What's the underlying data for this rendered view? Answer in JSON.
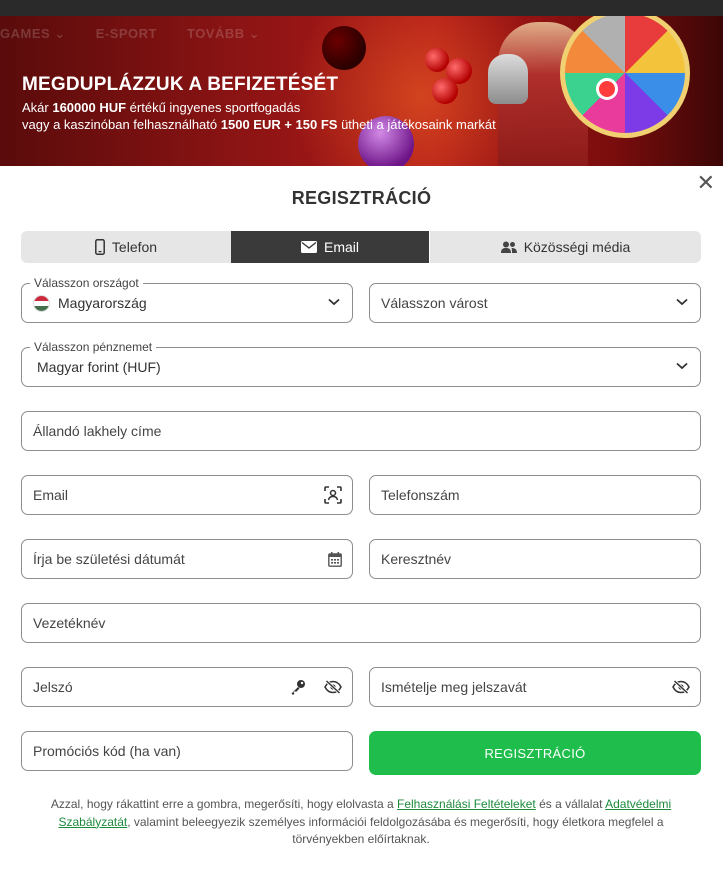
{
  "banner": {
    "nav_ghost": [
      "GAMES ⌄",
      "E-SPORT",
      "TOVÁBB ⌄"
    ],
    "title": "MEGDUPLÁZZUK A BEFIZETÉSÉT",
    "line1_pre": "Akár ",
    "line1_bold": "160000 HUF",
    "line1_post": " értékű ingyenes sportfogadás",
    "line2_pre": "vagy a kaszinóban felhasználható ",
    "line2_bold": "1500 EUR + 150 FS",
    "line2_post": " ütheti a játékosaink markát"
  },
  "modal": {
    "close": "✕",
    "title": "REGISZTRÁCIÓ",
    "tabs": [
      {
        "label": "Telefon",
        "icon": "phone-icon",
        "active": false
      },
      {
        "label": "Email",
        "icon": "envelope-icon",
        "active": true
      },
      {
        "label": "Közösségi média",
        "icon": "users-icon",
        "active": false
      }
    ],
    "country": {
      "legend": "Válasszon országot",
      "value": "Magyarország"
    },
    "city": {
      "placeholder": "Válasszon várost"
    },
    "currency": {
      "legend": "Válasszon pénznemet",
      "value": "Magyar forint (HUF)"
    },
    "address": {
      "placeholder": "Állandó lakhely címe"
    },
    "email": {
      "placeholder": "Email"
    },
    "phone": {
      "placeholder": "Telefonszám"
    },
    "birthdate": {
      "placeholder": "Írja be születési dátumát"
    },
    "firstname": {
      "placeholder": "Keresztnév"
    },
    "lastname": {
      "placeholder": "Vezetéknév"
    },
    "password": {
      "placeholder": "Jelszó"
    },
    "password_repeat": {
      "placeholder": "Ismételje meg jelszavát"
    },
    "promo": {
      "placeholder": "Promóciós kód (ha van)"
    },
    "submit_label": "REGISZTRÁCIÓ",
    "legal": {
      "part1": "Azzal, hogy rákattint erre a gombra, megerősíti, hogy elolvasta a ",
      "link1": "Felhasználási Feltételeket",
      "part2": " és a vállalat ",
      "link2": "Adatvédelmi Szabályzatát",
      "part3": ", valamint beleegyezik személyes információi feldolgozásába és megerősíti, hogy életkora megfelel a törvényekben előírtaknak."
    }
  },
  "colors": {
    "accent_green": "#1fbe4c",
    "active_tab": "#3a3a3a",
    "link_green": "#1d8a3c",
    "flag_hu": [
      "#cd2a3e",
      "#ffffff",
      "#436f4d"
    ]
  }
}
